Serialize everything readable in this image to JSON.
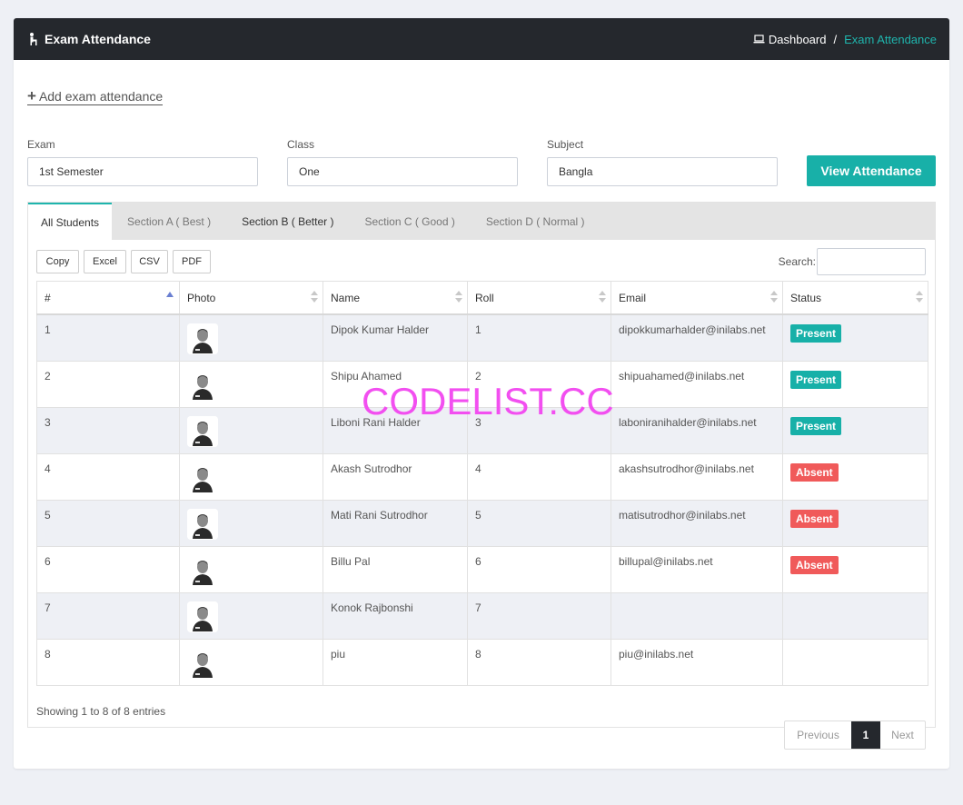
{
  "header": {
    "title": "Exam Attendance",
    "breadcrumb_home": "Dashboard",
    "breadcrumb_separator": "/",
    "breadcrumb_current": "Exam Attendance"
  },
  "add_link": "Add exam attendance",
  "filters": {
    "exam_label": "Exam",
    "exam_value": "1st Semester",
    "class_label": "Class",
    "class_value": "One",
    "subject_label": "Subject",
    "subject_value": "Bangla",
    "view_button": "View Attendance"
  },
  "tabs": [
    {
      "label": "All Students",
      "active": true
    },
    {
      "label": "Section A ( Best )"
    },
    {
      "label": "Section B ( Better )"
    },
    {
      "label": "Section C ( Good )"
    },
    {
      "label": "Section D ( Normal )"
    }
  ],
  "export_buttons": [
    "Copy",
    "Excel",
    "CSV",
    "PDF"
  ],
  "search_label": "Search:",
  "table": {
    "columns": [
      "#",
      "Photo",
      "Name",
      "Roll",
      "Email",
      "Status"
    ],
    "rows": [
      {
        "num": "1",
        "name": "Dipok Kumar Halder",
        "roll": "1",
        "email": "dipokkumarhalder@inilabs.net",
        "status": "Present"
      },
      {
        "num": "2",
        "name": "Shipu Ahamed",
        "roll": "2",
        "email": "shipuahamed@inilabs.net",
        "status": "Present"
      },
      {
        "num": "3",
        "name": "Liboni Rani Halder",
        "roll": "3",
        "email": "laboniranihalder@inilabs.net",
        "status": "Present"
      },
      {
        "num": "4",
        "name": "Akash Sutrodhor",
        "roll": "4",
        "email": "akashsutrodhor@inilabs.net",
        "status": "Absent"
      },
      {
        "num": "5",
        "name": "Mati Rani Sutrodhor",
        "roll": "5",
        "email": "matisutrodhor@inilabs.net",
        "status": "Absent"
      },
      {
        "num": "6",
        "name": "Billu Pal",
        "roll": "6",
        "email": "billupal@inilabs.net",
        "status": "Absent"
      },
      {
        "num": "7",
        "name": "Konok Rajbonshi",
        "roll": "7",
        "email": "",
        "status": ""
      },
      {
        "num": "8",
        "name": "piu",
        "roll": "8",
        "email": "piu@inilabs.net",
        "status": ""
      }
    ]
  },
  "info": "Showing 1 to 8 of 8 entries",
  "pagination": {
    "previous": "Previous",
    "current": "1",
    "next": "Next"
  },
  "watermark": "CODELIST.CC",
  "colors": {
    "accent": "#1fb5ad",
    "present": "#17b0a8",
    "absent": "#f05a5a",
    "header_bg": "#25282d"
  }
}
